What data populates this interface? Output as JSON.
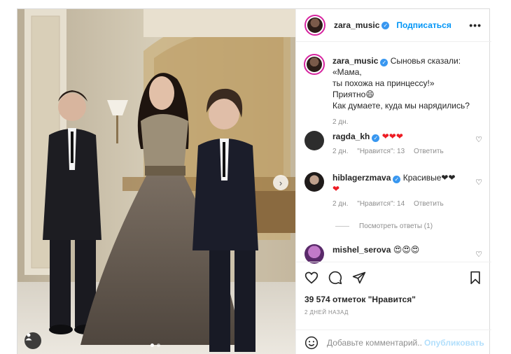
{
  "post": {
    "author": "zara_music",
    "follow_label": "Подписаться",
    "more_label": "•••",
    "caption": {
      "username": "zara_music",
      "line1": "Сыновья сказали: «Мама,",
      "line2": "ты похожа на принцессу!»",
      "line3": "Приятно😄",
      "line4": "Как думаете, куда мы нарядились?",
      "time": "2 дн."
    },
    "comments": [
      {
        "username": "ragda_kh",
        "text": "❤❤❤",
        "time": "2 дн.",
        "likes": "\"Нравится\": 13",
        "reply": "Ответить"
      },
      {
        "username": "hiblagerzmava",
        "text": "Красивые❤❤",
        "text2": "❤",
        "time": "2 дн.",
        "likes": "\"Нравится\": 14",
        "reply": "Ответить"
      },
      {
        "username": "mishel_serova",
        "text": "😍😍😍"
      }
    ],
    "view_replies": "Посмотреть ответы (1)",
    "likes_count": "39 574 отметок \"Нравится\"",
    "date": "2 ДНЕЙ НАЗАД",
    "comment_placeholder": "Добавьте комментарий...",
    "publish_label": "Опубликовать",
    "photo": {
      "slides": 2,
      "active_slide": 1
    },
    "colors": {
      "accent": "#0095f6",
      "verified": "#3897f0",
      "muted": "#8e8e8e",
      "heart": "#ed1c24"
    },
    "icons": [
      "heart-icon",
      "comment-icon",
      "share-icon",
      "bookmark-icon",
      "emoji-icon",
      "user-tag-icon",
      "chevron-right-icon",
      "verified-icon",
      "more-icon"
    ]
  }
}
